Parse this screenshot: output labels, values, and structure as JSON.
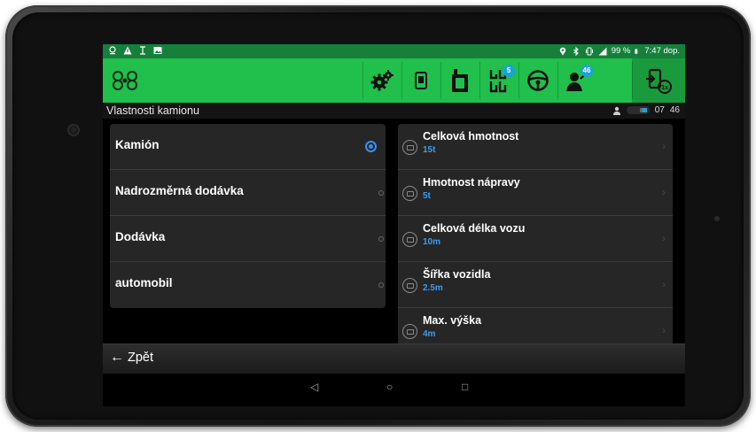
{
  "status_bar": {
    "battery": "99 %",
    "time": "7:47 dop."
  },
  "toolbar": {
    "icons": [
      "logo-icon",
      "gear-icon",
      "device-icon",
      "truck-icon",
      "route-icon",
      "steering-wheel-icon",
      "user-icon",
      "exit-icon"
    ],
    "route_badge": "5",
    "user_badge": "46"
  },
  "subheader": {
    "title": "Vlastnosti kamionu",
    "hours": "07",
    "count": "46"
  },
  "vehicle_types": [
    {
      "label": "Kamión",
      "selected": true
    },
    {
      "label": "Nadrozměrná dodávka",
      "selected": false
    },
    {
      "label": "Dodávka",
      "selected": false
    },
    {
      "label": "automobil",
      "selected": false
    }
  ],
  "properties": [
    {
      "name": "Celková hmotnost",
      "value": "15t"
    },
    {
      "name": "Hmotnost nápravy",
      "value": "5t"
    },
    {
      "name": "Celková délka vozu",
      "value": "10m"
    },
    {
      "name": "Šířka vozidla",
      "value": "2.5m"
    },
    {
      "name": "Max. výška",
      "value": "4m"
    }
  ],
  "footer": {
    "back_label": "Zpět",
    "back_arrow": "←"
  },
  "navbar": {
    "back": "◁",
    "home": "○",
    "recents": "□"
  },
  "colors": {
    "accent_green": "#21bf4c",
    "status_green": "#16803a",
    "value_blue": "#3b9cf0",
    "badge_blue": "#1ea0d8"
  }
}
